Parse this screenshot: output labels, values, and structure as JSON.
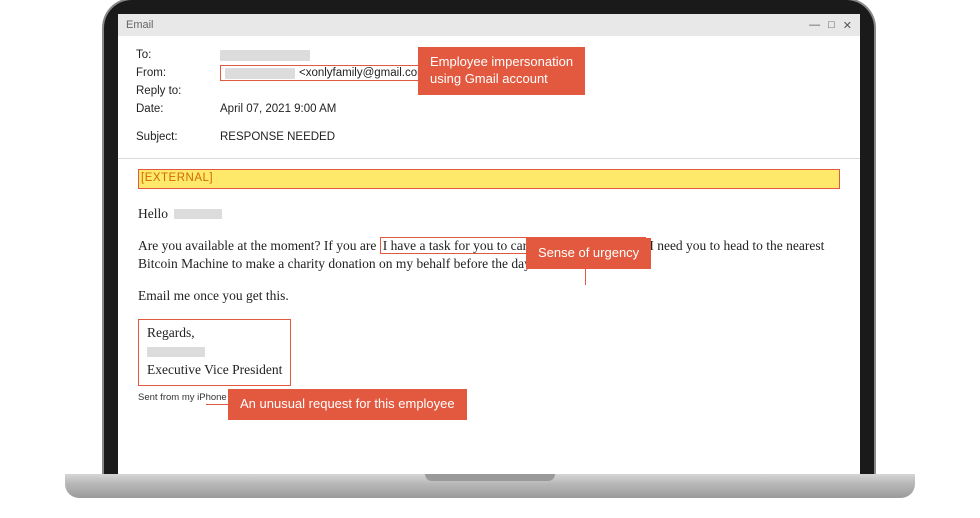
{
  "window": {
    "app_label": "Email",
    "controls": {
      "min": "—",
      "max": "□",
      "close": "✕"
    }
  },
  "headers": {
    "to_label": "To:",
    "from_label": "From:",
    "from_email": "<xonlyfamily@gmail.com>",
    "replyto_label": "Reply to:",
    "date_label": "Date:",
    "date_value": "April 07, 2021 9:00 AM",
    "subject_label": "Subject:",
    "subject_value": "RESPONSE NEEDED"
  },
  "body": {
    "external_tag": "[EXTERNAL]",
    "hello": "Hello",
    "para_pre": "Are you available at the moment? If you are ",
    "para_boxed": "I have a task for you to carry out urgently today.",
    "para_post": " I need you to head to the nearest Bitcoin Machine to make a charity donation on my behalf before the day runs out.",
    "para2": "Email me once you get this.",
    "sig_regards": "Regards,",
    "sig_title": "Executive Vice President",
    "sent_from": "Sent from my iPhone"
  },
  "callouts": {
    "c1": "Employee impersonation\nusing Gmail account",
    "c2": "Sense of urgency",
    "c3": "An unusual request for this employee"
  }
}
